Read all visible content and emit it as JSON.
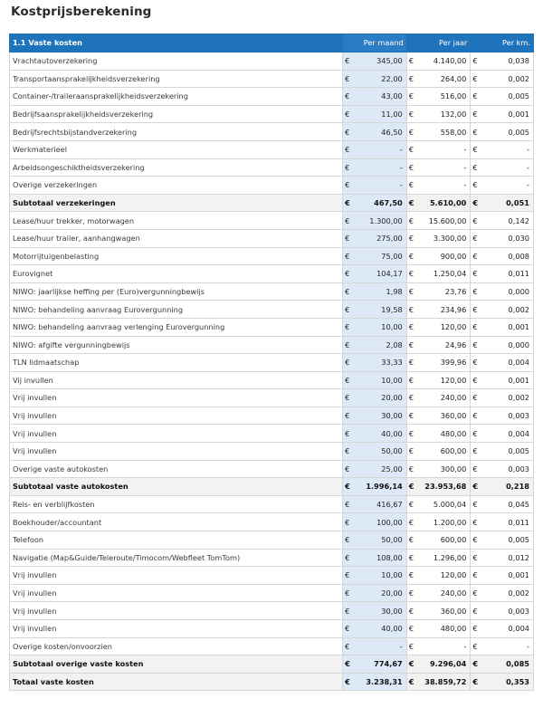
{
  "title": "Kostprijsberekening",
  "table": {
    "section_label": "1.1 Vaste kosten",
    "col_month": "Per maand",
    "col_year": "Per jaar",
    "col_km": "Per km.",
    "currency": "€",
    "rows": [
      {
        "label": "Vrachtautoverzekering",
        "m": "345,00",
        "y": "4.140,00",
        "k": "0,038",
        "type": "item"
      },
      {
        "label": "Transportaansprakelijkheidsverzekering",
        "m": "22,00",
        "y": "264,00",
        "k": "0,002",
        "type": "item"
      },
      {
        "label": "Container-/traileraansprakelijkheidsverzekering",
        "m": "43,00",
        "y": "516,00",
        "k": "0,005",
        "type": "item"
      },
      {
        "label": "Bedrijfsaansprakelijkheidsverzekering",
        "m": "11,00",
        "y": "132,00",
        "k": "0,001",
        "type": "item"
      },
      {
        "label": "Bedrijfsrechtsbijstandverzekering",
        "m": "46,50",
        "y": "558,00",
        "k": "0,005",
        "type": "item"
      },
      {
        "label": "Werkmaterieel",
        "m": "-",
        "y": "-",
        "k": "-",
        "type": "item"
      },
      {
        "label": "Arbeidsongeschiktheidsverzekering",
        "m": "-",
        "y": "-",
        "k": "-",
        "type": "item"
      },
      {
        "label": "Overige verzekeringen",
        "m": "-",
        "y": "-",
        "k": "-",
        "type": "item"
      },
      {
        "label": "Subtotaal verzekeringen",
        "m": "467,50",
        "y": "5.610,00",
        "k": "0,051",
        "type": "sub"
      },
      {
        "label": "Lease/huur trekker, motorwagen",
        "m": "1.300,00",
        "y": "15.600,00",
        "k": "0,142",
        "type": "item"
      },
      {
        "label": "Lease/huur trailer, aanhangwagen",
        "m": "275,00",
        "y": "3.300,00",
        "k": "0,030",
        "type": "item"
      },
      {
        "label": "Motorrijtuigenbelasting",
        "m": "75,00",
        "y": "900,00",
        "k": "0,008",
        "type": "item"
      },
      {
        "label": "Eurovignet",
        "m": "104,17",
        "y": "1.250,04",
        "k": "0,011",
        "type": "item"
      },
      {
        "label": "NIWO: jaarlijkse heffing per (Euro)vergunningbewijs",
        "m": "1,98",
        "y": "23,76",
        "k": "0,000",
        "type": "item"
      },
      {
        "label": "NIWO: behandeling aanvraag Eurovergunning",
        "m": "19,58",
        "y": "234,96",
        "k": "0,002",
        "type": "item"
      },
      {
        "label": "NIWO: behandeling aanvraag verlenging Eurovergunning",
        "m": "10,00",
        "y": "120,00",
        "k": "0,001",
        "type": "item"
      },
      {
        "label": "NIWO: afgifte vergunningbewijs",
        "m": "2,08",
        "y": "24,96",
        "k": "0,000",
        "type": "item"
      },
      {
        "label": "TLN lidmaatschap",
        "m": "33,33",
        "y": "399,96",
        "k": "0,004",
        "type": "item"
      },
      {
        "label": "Vij invullen",
        "m": "10,00",
        "y": "120,00",
        "k": "0,001",
        "type": "item"
      },
      {
        "label": "Vrij invullen",
        "m": "20,00",
        "y": "240,00",
        "k": "0,002",
        "type": "item"
      },
      {
        "label": "Vrij invullen",
        "m": "30,00",
        "y": "360,00",
        "k": "0,003",
        "type": "item"
      },
      {
        "label": "Vrij invullen",
        "m": "40,00",
        "y": "480,00",
        "k": "0,004",
        "type": "item"
      },
      {
        "label": "Vrij invullen",
        "m": "50,00",
        "y": "600,00",
        "k": "0,005",
        "type": "item"
      },
      {
        "label": "Overige vaste autokosten",
        "m": "25,00",
        "y": "300,00",
        "k": "0,003",
        "type": "item"
      },
      {
        "label": "Subtotaal vaste autokosten",
        "m": "1.996,14",
        "y": "23.953,68",
        "k": "0,218",
        "type": "sub"
      },
      {
        "label": "Reis- en verblijfkosten",
        "m": "416,67",
        "y": "5.000,04",
        "k": "0,045",
        "type": "item"
      },
      {
        "label": "Boekhouder/accountant",
        "m": "100,00",
        "y": "1.200,00",
        "k": "0,011",
        "type": "item"
      },
      {
        "label": "Telefoon",
        "m": "50,00",
        "y": "600,00",
        "k": "0,005",
        "type": "item"
      },
      {
        "label": "Navigatie (Map&Guide/Teleroute/Timocom/Webfleet TomTom)",
        "m": "108,00",
        "y": "1.296,00",
        "k": "0,012",
        "type": "item"
      },
      {
        "label": "Vrij invullen",
        "m": "10,00",
        "y": "120,00",
        "k": "0,001",
        "type": "item"
      },
      {
        "label": "Vrij invullen",
        "m": "20,00",
        "y": "240,00",
        "k": "0,002",
        "type": "item"
      },
      {
        "label": "Vrij invullen",
        "m": "30,00",
        "y": "360,00",
        "k": "0,003",
        "type": "item"
      },
      {
        "label": "Vrij invullen",
        "m": "40,00",
        "y": "480,00",
        "k": "0,004",
        "type": "item"
      },
      {
        "label": "Overige kosten/onvoorzien",
        "m": "-",
        "y": "-",
        "k": "-",
        "type": "item"
      },
      {
        "label": "Subtotaal overige vaste kosten",
        "m": "774,67",
        "y": "9.296,04",
        "k": "0,085",
        "type": "sub"
      },
      {
        "label": "Totaal vaste kosten",
        "m": "3.238,31",
        "y": "38.859,72",
        "k": "0,353",
        "type": "tot"
      }
    ]
  },
  "colors": {
    "header_bg": "#1f73bb",
    "month_highlight": "#dde9f6",
    "subtotal_bg": "#f2f2f2"
  }
}
